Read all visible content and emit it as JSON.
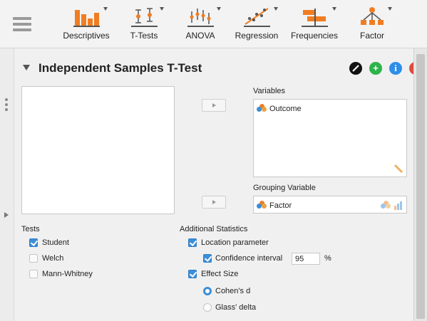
{
  "ribbon": {
    "menu_icon": "hamburger-icon",
    "buttons": [
      {
        "label": "Descriptives",
        "icon": "bar-chart-icon"
      },
      {
        "label": "T-Tests",
        "icon": "t-test-icon"
      },
      {
        "label": "ANOVA",
        "icon": "anova-icon"
      },
      {
        "label": "Regression",
        "icon": "scatter-regression-icon"
      },
      {
        "label": "Frequencies",
        "icon": "frequencies-icon"
      },
      {
        "label": "Factor",
        "icon": "factor-network-icon"
      }
    ]
  },
  "analysis": {
    "title": "Independent Samples T-Test",
    "actions": [
      "edit-icon",
      "add-icon",
      "info-icon",
      "close-icon"
    ]
  },
  "variables": {
    "label": "Variables",
    "items": [
      "Outcome"
    ]
  },
  "grouping": {
    "label": "Grouping Variable",
    "item": "Factor"
  },
  "tests": {
    "label": "Tests",
    "options": [
      {
        "label": "Student",
        "checked": true
      },
      {
        "label": "Welch",
        "checked": false
      },
      {
        "label": "Mann-Whitney",
        "checked": false
      }
    ]
  },
  "additional": {
    "label": "Additional Statistics",
    "location": {
      "label": "Location parameter",
      "checked": true
    },
    "ci": {
      "label": "Confidence interval",
      "checked": true,
      "value": "95",
      "unit": "%"
    },
    "effect": {
      "label": "Effect Size",
      "checked": true
    },
    "effect_options": [
      {
        "label": "Cohen's d",
        "selected": true
      },
      {
        "label": "Glass' delta",
        "selected": false
      }
    ]
  },
  "colors": {
    "accent": "#3c8fd8",
    "edit": "#111111",
    "add": "#2db34a",
    "info": "#2e8ee8",
    "close": "#e04a3c"
  }
}
